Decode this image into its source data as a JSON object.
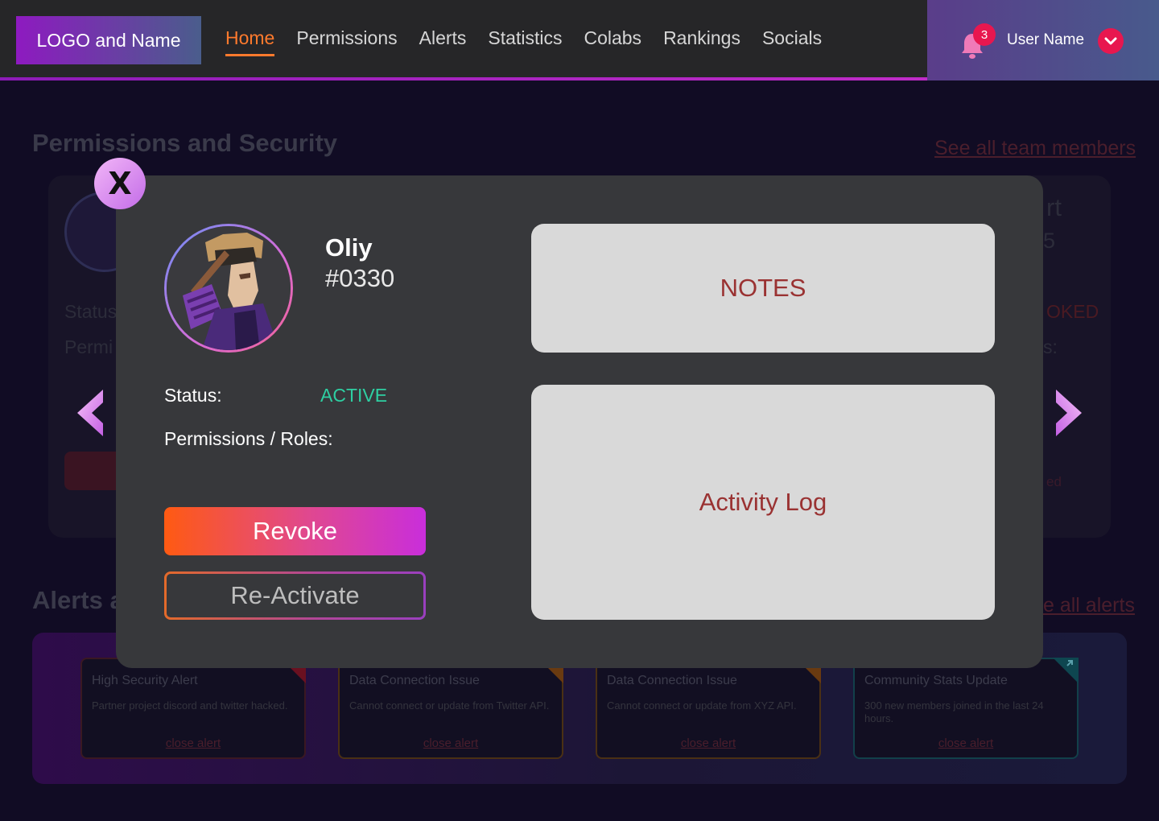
{
  "header": {
    "logo_text": "LOGO and Name",
    "nav": [
      {
        "label": "Home",
        "active": true
      },
      {
        "label": "Permissions"
      },
      {
        "label": "Alerts"
      },
      {
        "label": "Statistics"
      },
      {
        "label": "Colabs"
      },
      {
        "label": "Rankings"
      },
      {
        "label": "Socials"
      }
    ],
    "notification_count": "3",
    "user_name": "User Name"
  },
  "background": {
    "section_title": "Permissions and Security",
    "see_all_members": "See all team members",
    "card_status_fragment": "Status",
    "card_perm_fragment": "Permi",
    "card_right_title_fragment": "rt",
    "card_right_num_fragment": "5",
    "card_right_status_fragment": "OKED",
    "card_right_perm_fragment": "s:",
    "card_right_btn_fragment": "ed",
    "alerts_title_fragment": "Alerts a",
    "see_all_alerts_fragment": "e all alerts",
    "alerts": [
      {
        "title": "High Security Alert",
        "body": "Partner project discord and twitter hacked.",
        "close": "close alert",
        "color": "#c0183c"
      },
      {
        "title": "Data Connection Issue",
        "body": "Cannot connect or update from Twitter API.",
        "close": "close alert",
        "color": "#e07a1a"
      },
      {
        "title": "Data Connection Issue",
        "body": "Cannot connect or update from XYZ API.",
        "close": "close alert",
        "color": "#e07a1a"
      },
      {
        "title": "Community Stats Update",
        "body": "300 new members joined in the last 24 hours.",
        "close": "close alert",
        "color": "#1fa6b0"
      }
    ]
  },
  "modal": {
    "close_label": "X",
    "user": {
      "name": "Oliy",
      "tag": "#0330"
    },
    "status_label": "Status:",
    "status_value": "ACTIVE",
    "permissions_label": "Permissions / Roles:",
    "revoke_label": "Revoke",
    "reactivate_label": "Re-Activate",
    "notes_label": "NOTES",
    "activity_label": "Activity Log"
  },
  "colors": {
    "accent_orange": "#ff7a2d",
    "notification": "#e8174f",
    "status_active": "#2ecfa2"
  }
}
